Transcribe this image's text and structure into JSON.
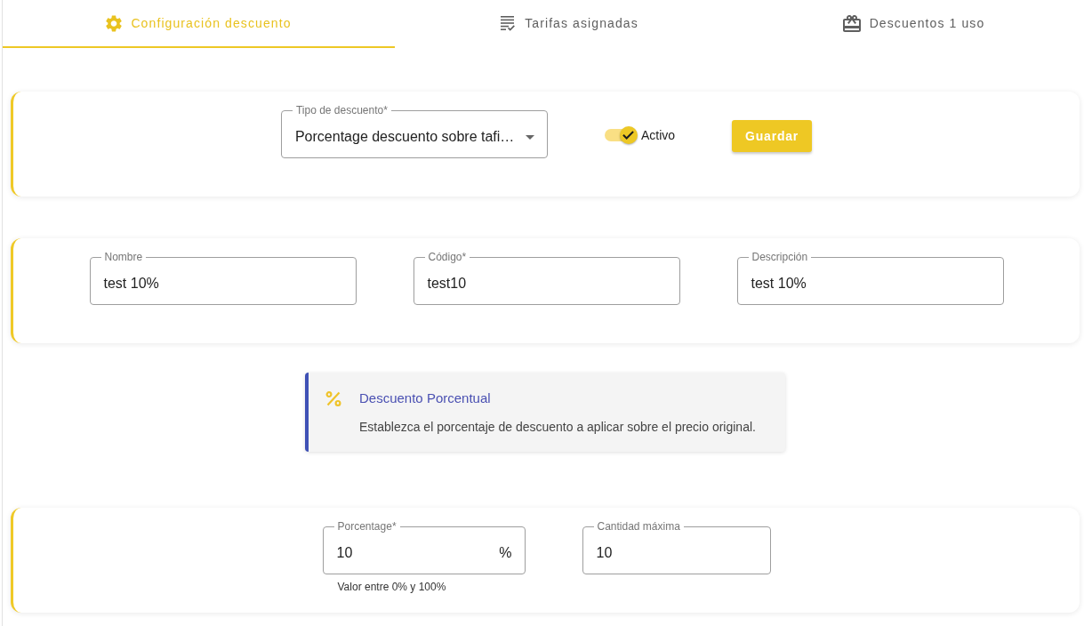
{
  "tabs": [
    {
      "label": "Configuración descuento",
      "selected": true
    },
    {
      "label": "Tarifas asignadas",
      "selected": false
    },
    {
      "label": "Descuentos 1 uso",
      "selected": false
    }
  ],
  "type_card": {
    "discount_type": {
      "label": "Tipo de descuento*",
      "value": "Porcentage descuento sobre tafi…"
    },
    "active_toggle": {
      "label": "Activo",
      "on": true
    },
    "save_button": "Guardar"
  },
  "general_card": {
    "fields": [
      {
        "label": "Nombre",
        "value": "test 10%"
      },
      {
        "label": "Código*",
        "value": "test10"
      },
      {
        "label": "Descripción",
        "value": "test 10%"
      }
    ]
  },
  "info": {
    "title": "Descuento Porcentual",
    "text": "Establezca el porcentaje de descuento a aplicar sobre el precio original."
  },
  "amount_card": {
    "fields": [
      {
        "label": "Porcentage*",
        "value": "10",
        "suffix": "%",
        "hint": "Valor entre 0% y 100%"
      },
      {
        "label": "Cantidad máxima",
        "value": "10"
      }
    ]
  }
}
